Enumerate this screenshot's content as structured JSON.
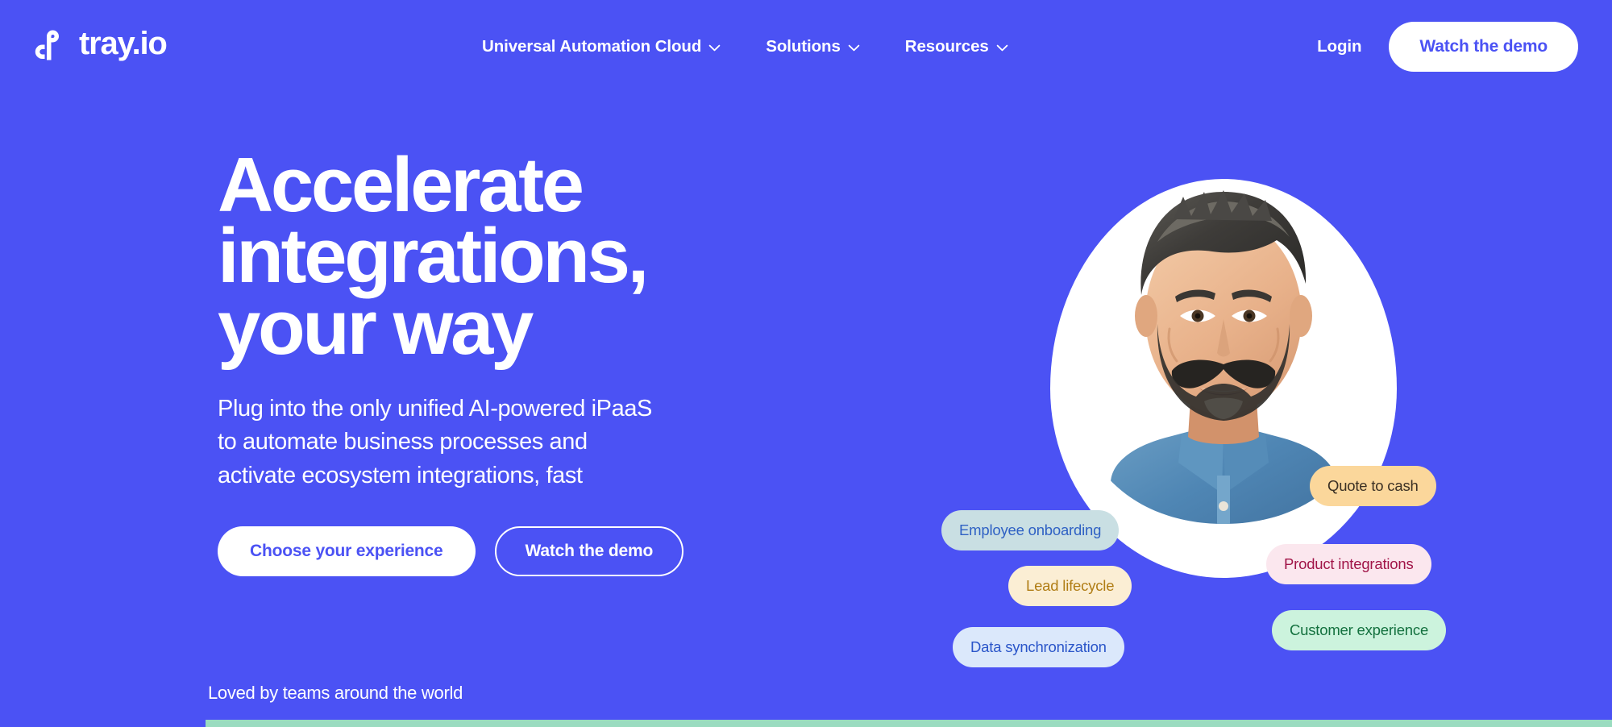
{
  "brand": {
    "name": "tray.io",
    "logo_icon": "tray-infinity-logo-icon",
    "background_color": "#4b52f4",
    "accent_color": "#ffffff"
  },
  "header": {
    "nav_items": [
      {
        "label": "Universal Automation Cloud",
        "icon": "chevron-down-icon",
        "has_dropdown": true
      },
      {
        "label": "Solutions",
        "icon": "chevron-down-icon",
        "has_dropdown": true
      },
      {
        "label": "Resources",
        "icon": "chevron-down-icon",
        "has_dropdown": true
      }
    ],
    "login_label": "Login",
    "demo_button_label": "Watch the demo"
  },
  "hero": {
    "title": "Accelerate\nintegrations,\nyour way",
    "subtitle": "Plug into the only unified AI-powered iPaaS\nto automate business processes and\nactivate ecosystem integrations, fast",
    "primary_cta": "Choose your experience",
    "secondary_cta": "Watch the demo"
  },
  "hero_visual": {
    "portrait_alt": "smiling-man-in-denim-shirt",
    "blob_color": "#ffffff",
    "pills": [
      {
        "label": "Employee onboarding",
        "background": "#c9dfe3",
        "text_color": "#2f61c4"
      },
      {
        "label": "Lead lifecycle",
        "background": "#fbeed4",
        "text_color": "#b07d15"
      },
      {
        "label": "Data synchronization",
        "background": "#dbe8fb",
        "text_color": "#2a55c9"
      },
      {
        "label": "Quote to cash",
        "background": "#fbd79b",
        "text_color": "#3b3024"
      },
      {
        "label": "Product integrations",
        "background": "#fbe7ee",
        "text_color": "#a11548"
      },
      {
        "label": "Customer experience",
        "background": "#ccf3dd",
        "text_color": "#14713f"
      }
    ]
  },
  "social_proof": {
    "label": "Loved by teams around the world",
    "strip_color": "#9adcc0"
  }
}
